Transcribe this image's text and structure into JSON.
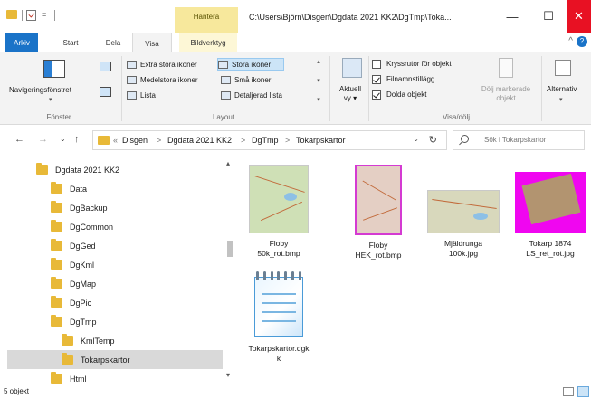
{
  "window": {
    "title": "C:\\Users\\Björn\\Disgen\\Dgdata 2021 KK2\\DgTmp\\Toka...",
    "contextual_tab": "Hantera",
    "minimize_symbol": "—",
    "maximize_symbol": "☐",
    "close_symbol": "✕",
    "quick_access_symbol": "="
  },
  "tabs": {
    "arkiv": "Arkiv",
    "start": "Start",
    "dela": "Dela",
    "visa": "Visa",
    "bildverktyg": "Bildverktyg",
    "collapse_symbol": "^",
    "help_symbol": "?"
  },
  "ribbon": {
    "panes": {
      "navigation_pane": "Navigeringsfönstret",
      "group_label": "Fönster"
    },
    "layout": {
      "items": [
        "Extra stora ikoner",
        "Stora ikoner",
        "Medelstora ikoner",
        "Små ikoner",
        "Lista",
        "Detaljerad lista"
      ],
      "group_label": "Layout"
    },
    "current_view": {
      "label_line1": "Aktuell",
      "label_line2": "vy ▾"
    },
    "show_hide": {
      "item_checkboxes": {
        "label": "Kryssrutor för objekt",
        "checked": false
      },
      "file_extensions": {
        "label": "Filnamnstillägg",
        "checked": true
      },
      "hidden_items": {
        "label": "Dolda objekt",
        "checked": true
      },
      "hide_selected_line1": "Dölj markerade",
      "hide_selected_line2": "objekt",
      "group_label": "Visa/dölj"
    },
    "options_label": "Alternativ"
  },
  "address": {
    "back": "←",
    "forward": "→",
    "recent": "⌄",
    "up": "↑",
    "overflow": "«",
    "crumbs": [
      "Disgen",
      "Dgdata 2021 KK2",
      "DgTmp",
      "Tokarpskartor"
    ],
    "separator": ">",
    "dropdown_symbol": "⌄",
    "refresh_symbol": "↻",
    "search_placeholder": "Sök i Tokarpskartor"
  },
  "nav_tree": [
    {
      "label": "Dgdata 2021 KK2",
      "level": 1
    },
    {
      "label": "Data",
      "level": 2
    },
    {
      "label": "DgBackup",
      "level": 2
    },
    {
      "label": "DgCommon",
      "level": 2
    },
    {
      "label": "DgGed",
      "level": 2
    },
    {
      "label": "DgKml",
      "level": 2
    },
    {
      "label": "DgMap",
      "level": 2
    },
    {
      "label": "DgPic",
      "level": 2
    },
    {
      "label": "DgTmp",
      "level": 2
    },
    {
      "label": "KmlTemp",
      "level": 3
    },
    {
      "label": "Tokarpskartor",
      "level": 3,
      "selected": true
    },
    {
      "label": "Html",
      "level": 2
    }
  ],
  "files": [
    {
      "line1": "Floby",
      "line2": "50k_rot.bmp",
      "thumb": "map-green"
    },
    {
      "line1": "Floby",
      "line2": "HEK_rot.bmp",
      "thumb": "map-pink-border"
    },
    {
      "line1": "Mjäldrunga",
      "line2": "100k.jpg",
      "thumb": "map-landscape"
    },
    {
      "line1": "Tokarp 1874",
      "line2": "LS_ret_rot.jpg",
      "thumb": "map-magenta"
    },
    {
      "line1": "Tokarpskartor.dgk",
      "line2": "k",
      "thumb": "notepad-icon"
    }
  ],
  "status": {
    "count": "5 objekt"
  },
  "colors": {
    "accent": "#1a73c8",
    "folder": "#e8b938",
    "selection": "#cce4f7",
    "close_red": "#e81123",
    "contextual_tab": "#f7e89c"
  }
}
